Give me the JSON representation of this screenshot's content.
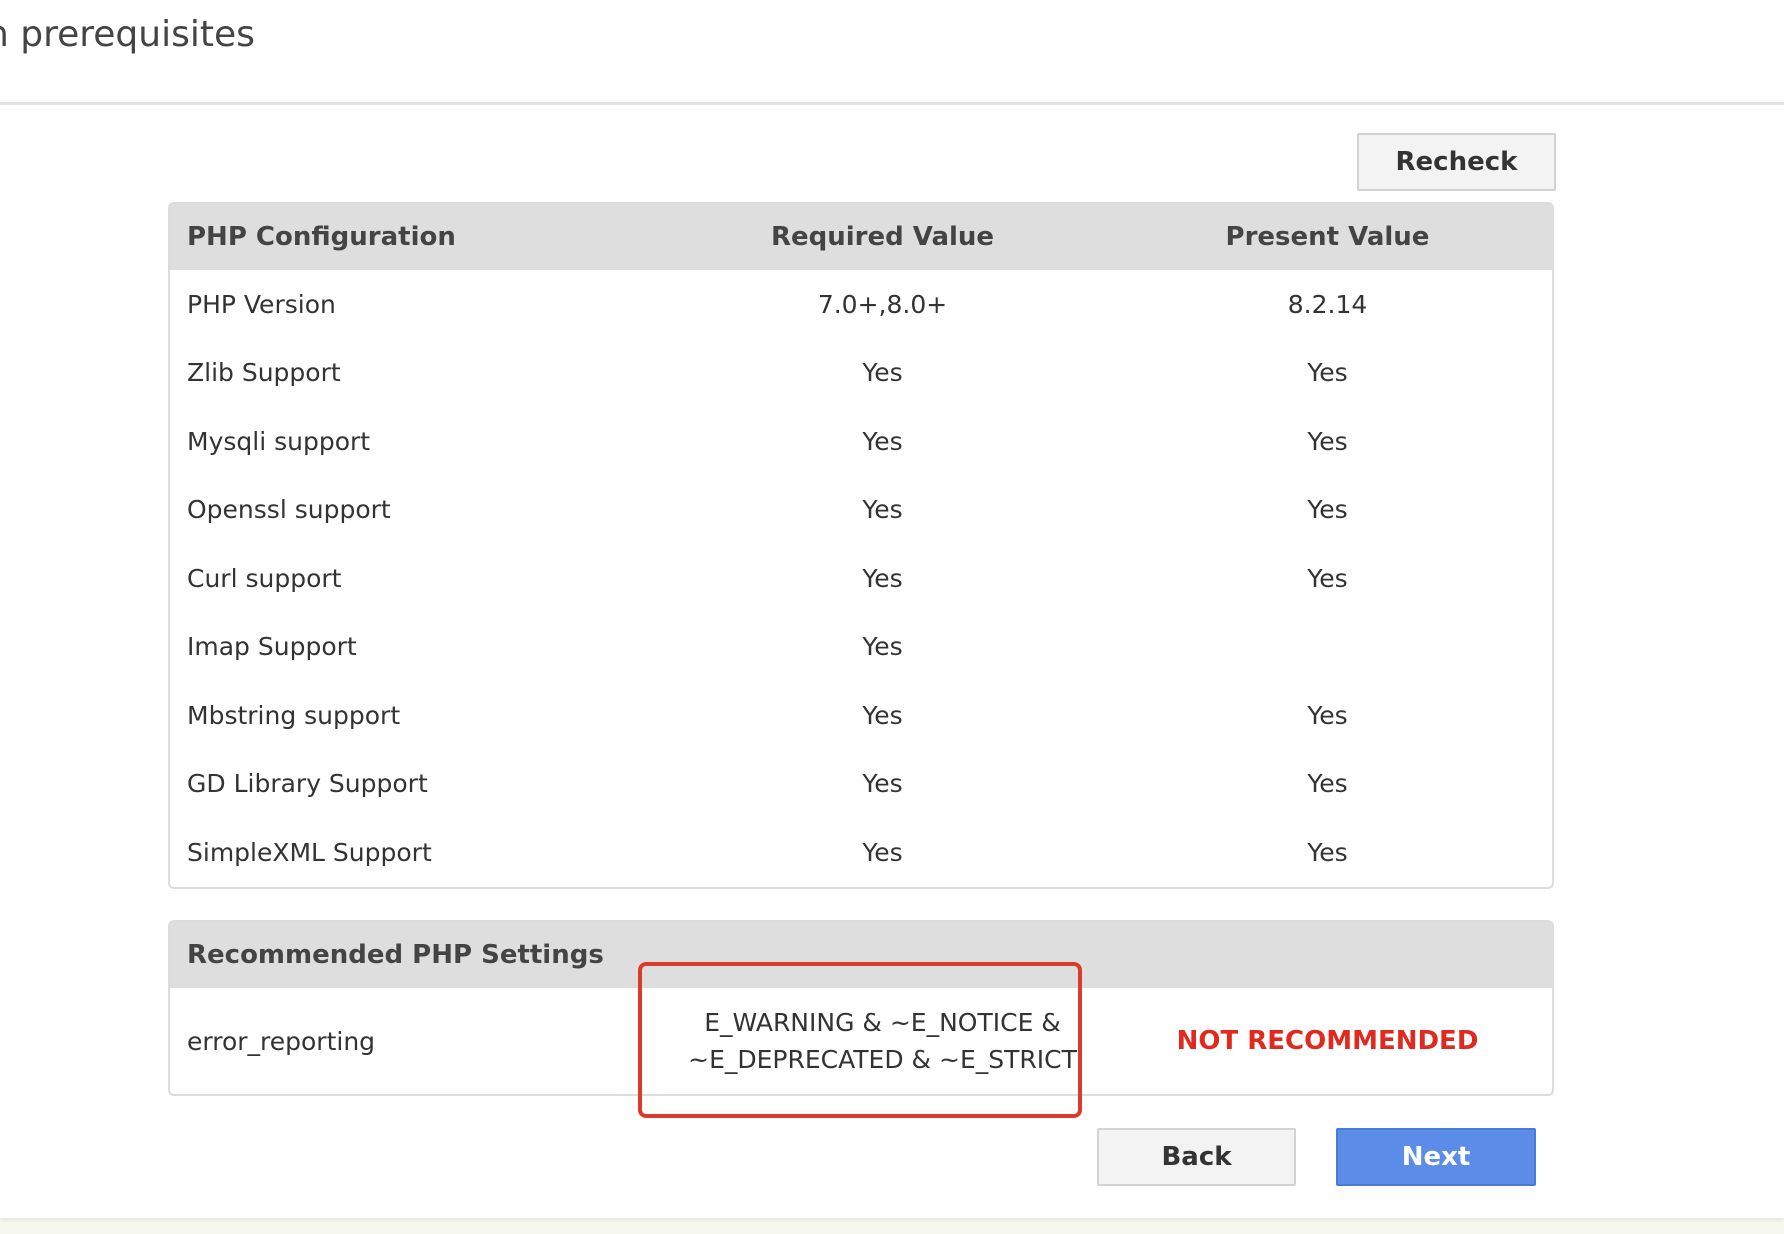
{
  "header": {
    "title": "n prerequisites"
  },
  "toolbar": {
    "recheck_label": "Recheck"
  },
  "config_table": {
    "headers": [
      "PHP Configuration",
      "Required Value",
      "Present Value"
    ],
    "rows": [
      [
        "PHP Version",
        "7.0+,8.0+",
        "8.2.14"
      ],
      [
        "Zlib Support",
        "Yes",
        "Yes"
      ],
      [
        "Mysqli support",
        "Yes",
        "Yes"
      ],
      [
        "Openssl support",
        "Yes",
        "Yes"
      ],
      [
        "Curl support",
        "Yes",
        "Yes"
      ],
      [
        "Imap Support",
        "Yes",
        ""
      ],
      [
        "Mbstring support",
        "Yes",
        "Yes"
      ],
      [
        "GD Library Support",
        "Yes",
        "Yes"
      ],
      [
        "SimpleXML Support",
        "Yes",
        "Yes"
      ]
    ]
  },
  "recommended": {
    "header": "Recommended PHP Settings",
    "setting": "error_reporting",
    "value_line1": "E_WARNING & ~E_NOTICE &",
    "value_line2": "~E_DEPRECATED & ~E_STRICT",
    "status": "NOT RECOMMENDED",
    "status_color": "#e02a1f"
  },
  "nav": {
    "back_label": "Back",
    "next_label": "Next"
  },
  "colors": {
    "primary": "#5b8de8",
    "highlight": "#dd3a2e",
    "table_header_bg": "#dedede"
  }
}
